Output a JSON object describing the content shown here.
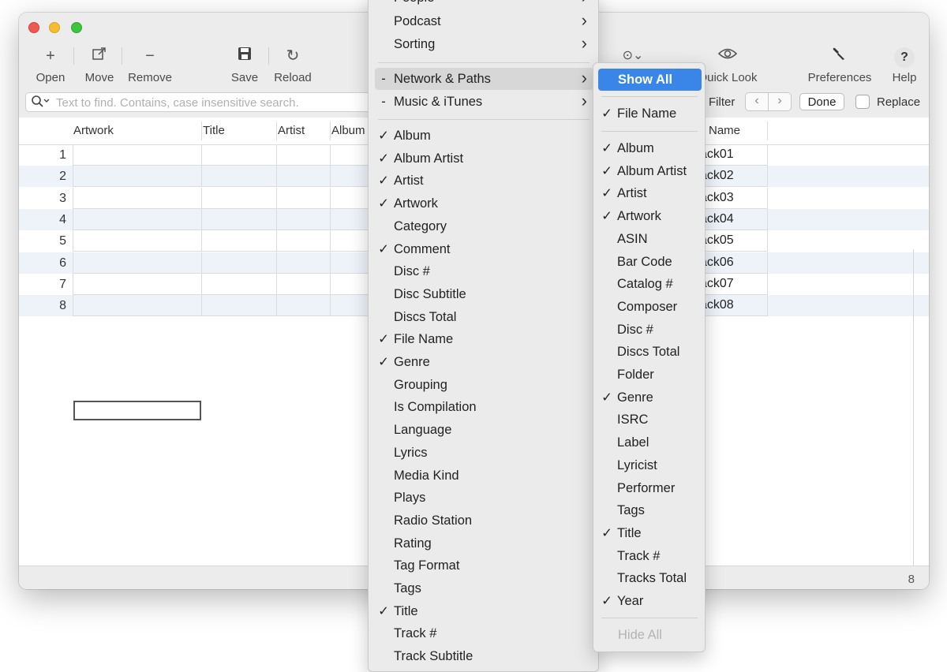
{
  "toolbar": {
    "open": "Open",
    "move": "Move",
    "remove": "Remove",
    "save": "Save",
    "reload": "Reload",
    "quick_look": "Quick Look",
    "preferences": "Preferences",
    "help": "Help"
  },
  "search": {
    "placeholder": "Text to find. Contains, case insensitive search.",
    "filter_label": "Filter",
    "done_label": "Done",
    "replace_label": "Replace"
  },
  "table": {
    "columns": [
      "Artwork",
      "Title",
      "Artist",
      "Album",
      "Name"
    ],
    "row_numbers": [
      "1",
      "2",
      "3",
      "4",
      "5",
      "6",
      "7",
      "8"
    ],
    "name_values": [
      "ack01",
      "ack02",
      "ack03",
      "ack04",
      "ack05",
      "ack06",
      "ack07",
      "ack08"
    ]
  },
  "status": {
    "count": "8"
  },
  "menu_main": {
    "items": [
      {
        "label": "People",
        "check": "-",
        "arrow": true
      },
      {
        "label": "Podcast",
        "check": "",
        "arrow": true
      },
      {
        "label": "Sorting",
        "check": "",
        "arrow": true
      },
      {
        "label": "Network & Paths",
        "check": "-",
        "arrow": true,
        "highlighted": true
      },
      {
        "label": "Music & iTunes",
        "check": "-",
        "arrow": true
      },
      {
        "label": "Album",
        "check": "✓"
      },
      {
        "label": "Album Artist",
        "check": "✓"
      },
      {
        "label": "Artist",
        "check": "✓"
      },
      {
        "label": "Artwork",
        "check": "✓"
      },
      {
        "label": "Category",
        "check": ""
      },
      {
        "label": "Comment",
        "check": "✓"
      },
      {
        "label": "Disc #",
        "check": ""
      },
      {
        "label": "Disc Subtitle",
        "check": ""
      },
      {
        "label": "Discs Total",
        "check": ""
      },
      {
        "label": "File Name",
        "check": "✓"
      },
      {
        "label": "Genre",
        "check": "✓"
      },
      {
        "label": "Grouping",
        "check": ""
      },
      {
        "label": "Is Compilation",
        "check": ""
      },
      {
        "label": "Language",
        "check": ""
      },
      {
        "label": "Lyrics",
        "check": ""
      },
      {
        "label": "Media Kind",
        "check": ""
      },
      {
        "label": "Plays",
        "check": ""
      },
      {
        "label": "Radio Station",
        "check": ""
      },
      {
        "label": "Rating",
        "check": ""
      },
      {
        "label": "Tag Format",
        "check": ""
      },
      {
        "label": "Tags",
        "check": ""
      },
      {
        "label": "Title",
        "check": "✓"
      },
      {
        "label": "Track #",
        "check": ""
      },
      {
        "label": "Track Subtitle",
        "check": ""
      }
    ]
  },
  "menu_sub": {
    "show_all": "Show All",
    "file_name": {
      "label": "File Name",
      "check": "✓"
    },
    "items": [
      {
        "label": "Album",
        "check": "✓"
      },
      {
        "label": "Album Artist",
        "check": "✓"
      },
      {
        "label": "Artist",
        "check": "✓"
      },
      {
        "label": "Artwork",
        "check": "✓"
      },
      {
        "label": "ASIN",
        "check": ""
      },
      {
        "label": "Bar Code",
        "check": ""
      },
      {
        "label": "Catalog #",
        "check": ""
      },
      {
        "label": "Composer",
        "check": ""
      },
      {
        "label": "Disc #",
        "check": ""
      },
      {
        "label": "Discs Total",
        "check": ""
      },
      {
        "label": "Folder",
        "check": ""
      },
      {
        "label": "Genre",
        "check": "✓"
      },
      {
        "label": "ISRC",
        "check": ""
      },
      {
        "label": "Label",
        "check": ""
      },
      {
        "label": "Lyricist",
        "check": ""
      },
      {
        "label": "Performer",
        "check": ""
      },
      {
        "label": "Tags",
        "check": ""
      },
      {
        "label": "Title",
        "check": "✓"
      },
      {
        "label": "Track #",
        "check": ""
      },
      {
        "label": "Tracks Total",
        "check": ""
      },
      {
        "label": "Year",
        "check": "✓"
      }
    ],
    "hide_all": "Hide All"
  },
  "colors": {
    "accent": "#3a86e8",
    "close": "#ee5a52",
    "minimize": "#f5be30",
    "maximize": "#3fc43f",
    "row_alt": "#eef3fa"
  }
}
